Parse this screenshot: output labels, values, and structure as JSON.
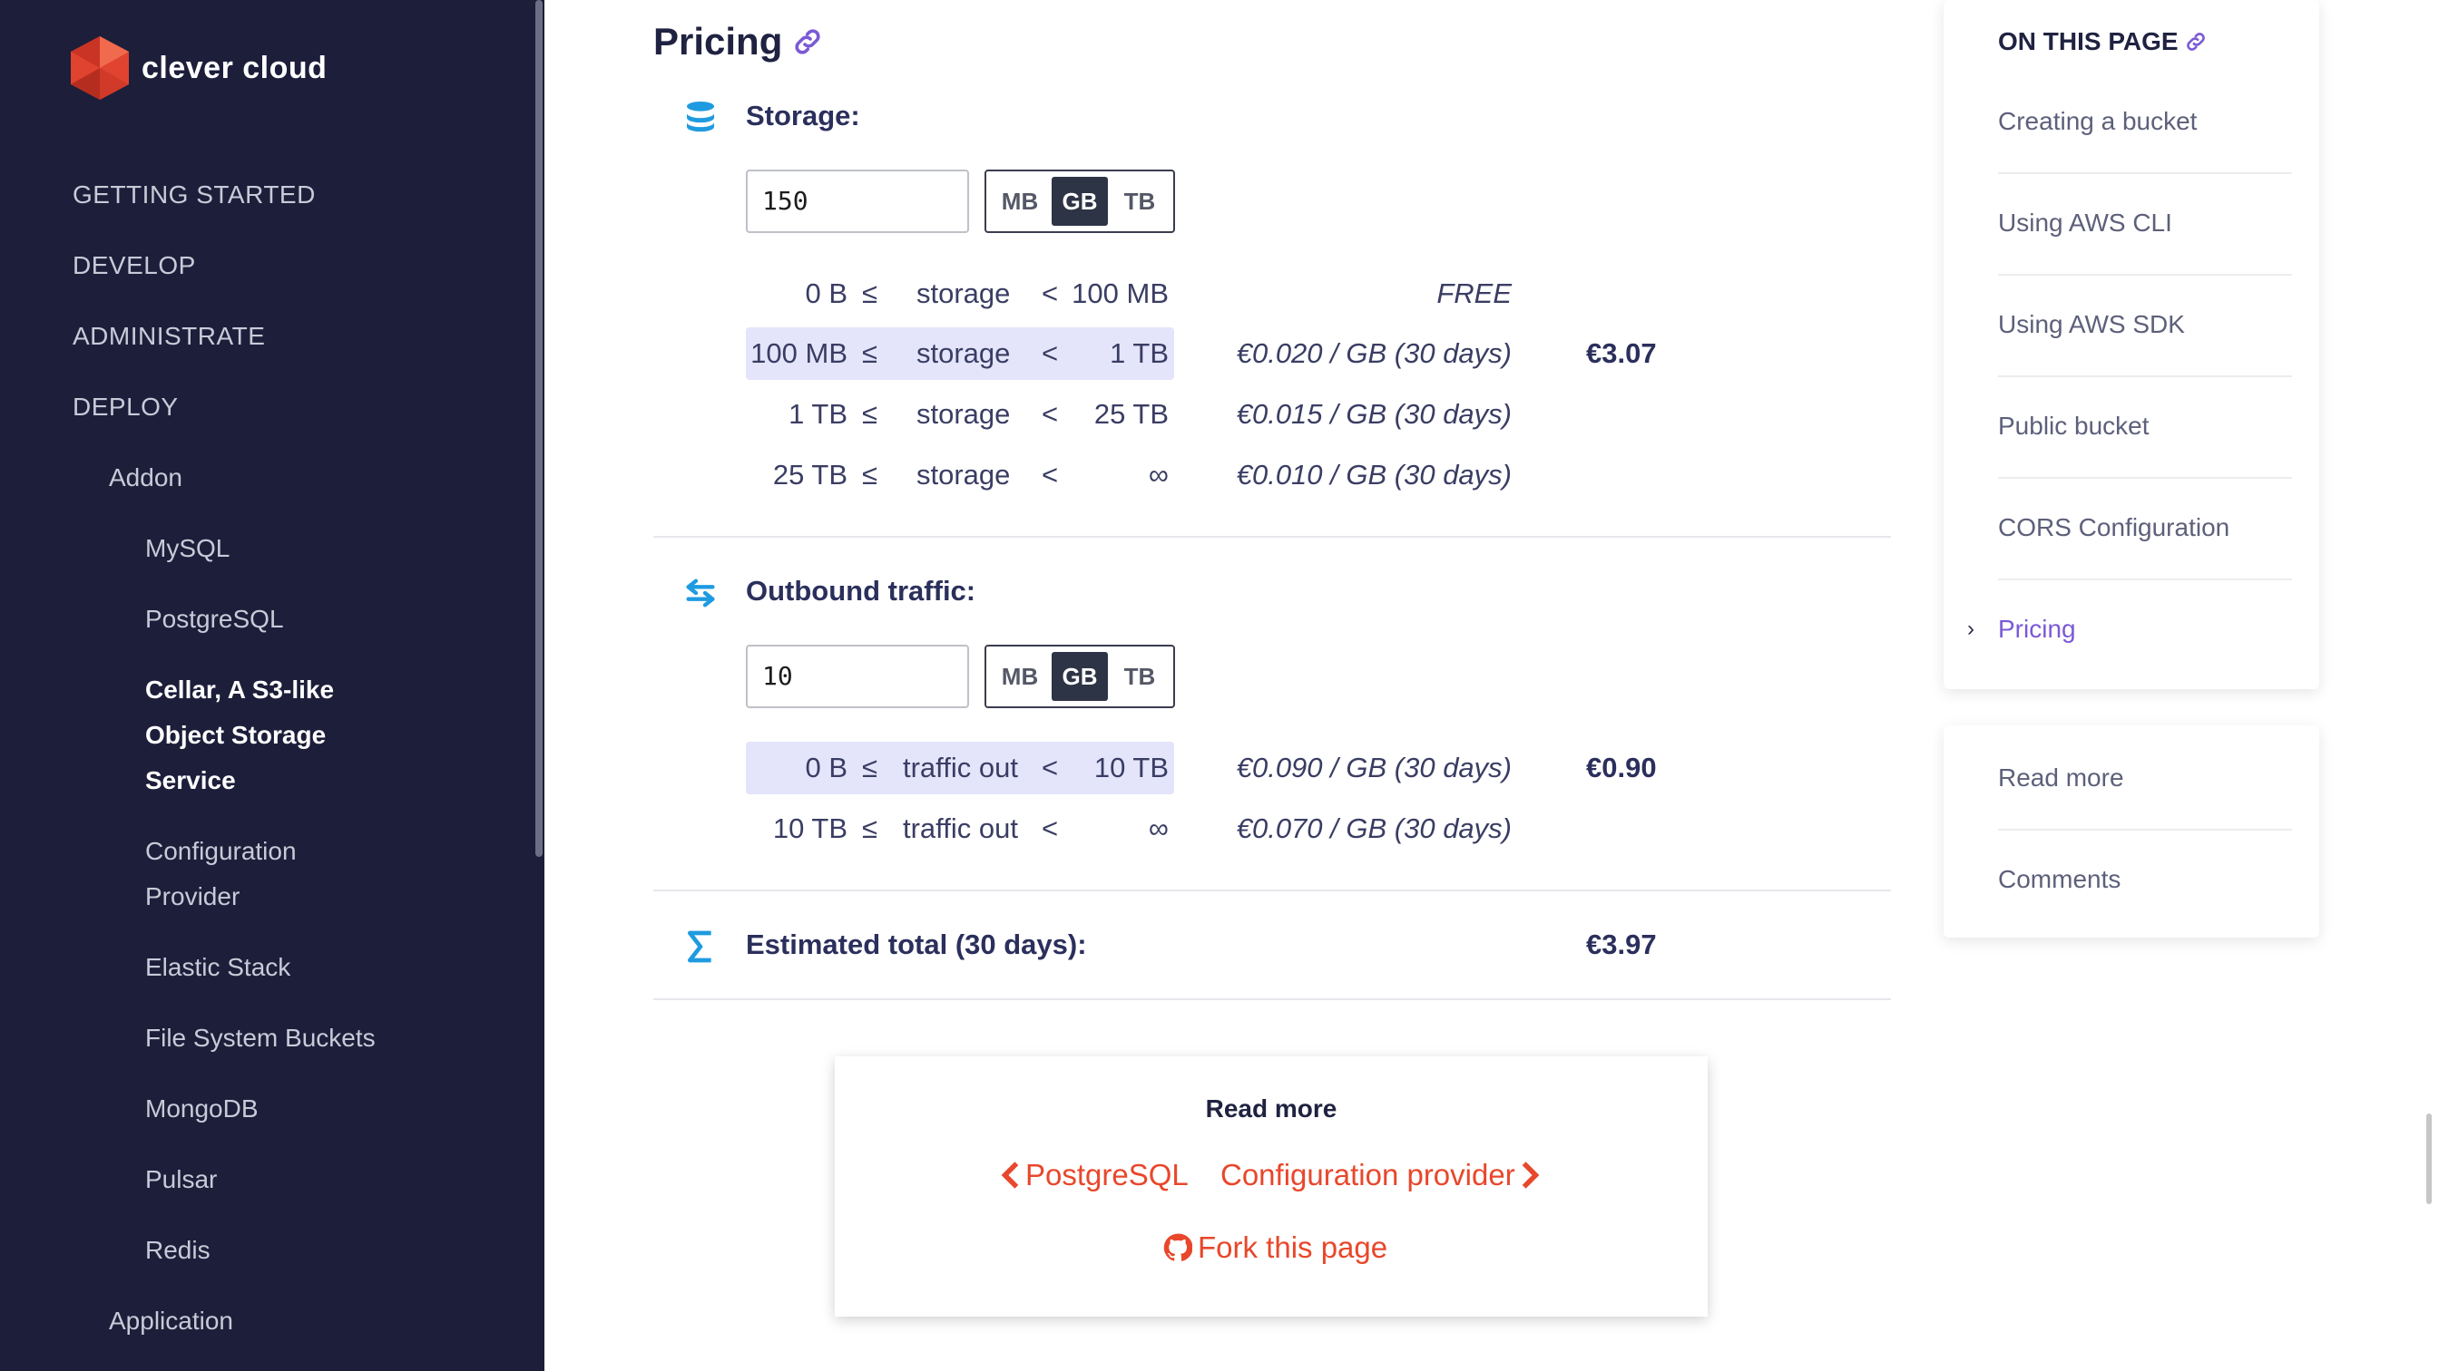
{
  "brand": {
    "name": "clever cloud"
  },
  "sidebar": {
    "items": [
      {
        "label": "GETTING STARTED"
      },
      {
        "label": "DEVELOP"
      },
      {
        "label": "ADMINISTRATE"
      },
      {
        "label": "DEPLOY"
      },
      {
        "label": "Addon"
      },
      {
        "label": "MySQL"
      },
      {
        "label": "PostgreSQL"
      },
      {
        "label": "Cellar, A S3-like"
      },
      {
        "label": "Object Storage"
      },
      {
        "label": "Service"
      },
      {
        "label": "Configuration"
      },
      {
        "label": "Provider"
      },
      {
        "label": "Elastic Stack"
      },
      {
        "label": "File System Buckets"
      },
      {
        "label": "MongoDB"
      },
      {
        "label": "Pulsar"
      },
      {
        "label": "Redis"
      },
      {
        "label": "Application"
      }
    ]
  },
  "main": {
    "heading": "Pricing",
    "storage": {
      "title": "Storage:",
      "input_value": "150",
      "units": [
        "MB",
        "GB",
        "TB"
      ],
      "selected_unit": "GB",
      "rows": [
        {
          "from": "0 B",
          "op1": "≤",
          "label": "storage",
          "op2": "<",
          "to": "100 MB",
          "price": "FREE",
          "amount": ""
        },
        {
          "from": "100 MB",
          "op1": "≤",
          "label": "storage",
          "op2": "<",
          "to": "1 TB",
          "price": "€0.020 / GB (30 days)",
          "amount": "€3.07"
        },
        {
          "from": "1 TB",
          "op1": "≤",
          "label": "storage",
          "op2": "<",
          "to": "25 TB",
          "price": "€0.015 / GB (30 days)",
          "amount": ""
        },
        {
          "from": "25 TB",
          "op1": "≤",
          "label": "storage",
          "op2": "<",
          "to": "∞",
          "price": "€0.010 / GB (30 days)",
          "amount": ""
        }
      ]
    },
    "traffic": {
      "title": "Outbound traffic:",
      "input_value": "10",
      "units": [
        "MB",
        "GB",
        "TB"
      ],
      "selected_unit": "GB",
      "rows": [
        {
          "from": "0 B",
          "op1": "≤",
          "label": "traffic out",
          "op2": "<",
          "to": "10 TB",
          "price": "€0.090 / GB (30 days)",
          "amount": "€0.90"
        },
        {
          "from": "10 TB",
          "op1": "≤",
          "label": "traffic out",
          "op2": "<",
          "to": "∞",
          "price": "€0.070 / GB (30 days)",
          "amount": ""
        }
      ]
    },
    "total": {
      "label": "Estimated total (30 days):",
      "amount": "€3.97"
    },
    "read_more": {
      "title": "Read more",
      "prev": "PostgreSQL",
      "next": "Configuration provider",
      "fork": "Fork this page"
    }
  },
  "toc": {
    "title": "ON THIS PAGE",
    "items": [
      {
        "label": "Creating a bucket"
      },
      {
        "label": "Using AWS CLI"
      },
      {
        "label": "Using AWS SDK"
      },
      {
        "label": "Public bucket"
      },
      {
        "label": "CORS Configuration"
      },
      {
        "label": "Pricing"
      }
    ],
    "extra": [
      {
        "label": "Read more"
      },
      {
        "label": "Comments"
      }
    ]
  },
  "colors": {
    "sidebar_bg": "#1d1e3a",
    "accent": "#7a5ad6",
    "link_red": "#e8472b",
    "highlight_row": "#e4e5fb",
    "icon_blue": "#1e9be0"
  },
  "icons": [
    "hexagon-logo-icon",
    "link-icon",
    "database-icon",
    "transfer-icon",
    "sigma-icon",
    "chevron-left-icon",
    "chevron-right-icon",
    "github-icon",
    "chevron-right-toc-icon"
  ]
}
